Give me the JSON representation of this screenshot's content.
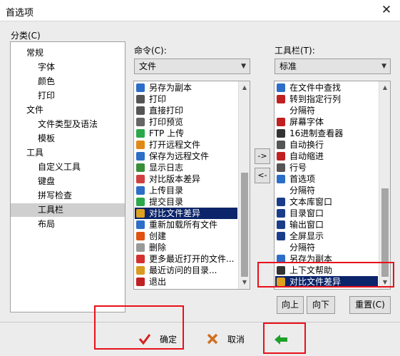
{
  "window": {
    "title": "首选项",
    "close_glyph": "✕"
  },
  "categories": {
    "label": "分类(C)",
    "items": [
      {
        "label": "常规",
        "level": 0
      },
      {
        "label": "字体",
        "level": 1
      },
      {
        "label": "颜色",
        "level": 1
      },
      {
        "label": "打印",
        "level": 1
      },
      {
        "label": "文件",
        "level": 0
      },
      {
        "label": "文件类型及语法",
        "level": 1
      },
      {
        "label": "模板",
        "level": 1
      },
      {
        "label": "工具",
        "level": 0
      },
      {
        "label": "自定义工具",
        "level": 1
      },
      {
        "label": "键盘",
        "level": 1
      },
      {
        "label": "拼写检查",
        "level": 1
      },
      {
        "label": "工具栏",
        "level": 1,
        "selected": true
      },
      {
        "label": "布局",
        "level": 1
      }
    ]
  },
  "commands": {
    "label": "命令(C):",
    "selected_group": "文件",
    "items": [
      {
        "label": "另存为副本",
        "icon": "save-copy-icon",
        "color": "#2c6ec7"
      },
      {
        "label": "打印",
        "icon": "print-icon",
        "color": "#555555"
      },
      {
        "label": "直接打印",
        "icon": "direct-print-icon",
        "color": "#555555"
      },
      {
        "label": "打印预览",
        "icon": "print-preview-icon",
        "color": "#666666"
      },
      {
        "label": "FTP 上传",
        "icon": "ftp-upload-icon",
        "color": "#2aa84a"
      },
      {
        "label": "打开远程文件",
        "icon": "open-remote-icon",
        "color": "#e08a16"
      },
      {
        "label": "保存为远程文件",
        "icon": "save-remote-icon",
        "color": "#2c6ec7"
      },
      {
        "label": "显示日志",
        "icon": "log-icon",
        "color": "#3a8e3a"
      },
      {
        "label": "对比版本差异",
        "icon": "version-diff-icon",
        "color": "#d04040"
      },
      {
        "label": "上传目录",
        "icon": "upload-dir-icon",
        "color": "#2c6ec7"
      },
      {
        "label": "提交目录",
        "icon": "commit-dir-icon",
        "color": "#2aa84a"
      },
      {
        "label": "对比文件差异",
        "icon": "file-diff-icon",
        "color": "#e0a020",
        "highlight": true
      },
      {
        "label": "重新加载所有文件",
        "icon": "reload-all-icon",
        "color": "#2c6ec7"
      },
      {
        "label": "创建",
        "icon": "create-icon",
        "color": "#e05010"
      },
      {
        "label": "删除",
        "icon": "delete-icon",
        "color": "#999999"
      },
      {
        "label": "更多最近打开的文件...",
        "icon": "recent-files-icon",
        "color": "#d43030"
      },
      {
        "label": "最近访问的目录...",
        "icon": "recent-dirs-icon",
        "color": "#d89a20"
      },
      {
        "label": "退出",
        "icon": "exit-icon",
        "color": "#c02020"
      }
    ]
  },
  "toolbar": {
    "label": "工具栏(T):",
    "selected_toolbar": "标准",
    "items": [
      {
        "label": "在文件中查找",
        "icon": "find-in-files-icon",
        "color": "#2c6ec7"
      },
      {
        "label": "转到指定行列",
        "icon": "goto-line-icon",
        "color": "#c02020"
      },
      {
        "label": "分隔符",
        "icon": "",
        "color": ""
      },
      {
        "label": "屏幕字体",
        "icon": "screen-font-icon",
        "color": "#c02020"
      },
      {
        "label": "16进制查看器",
        "icon": "hex-viewer-icon",
        "color": "#333333"
      },
      {
        "label": "自动换行",
        "icon": "word-wrap-icon",
        "color": "#555555"
      },
      {
        "label": "自动缩进",
        "icon": "auto-indent-icon",
        "color": "#c02020"
      },
      {
        "label": "行号",
        "icon": "line-number-icon",
        "color": "#555555"
      },
      {
        "label": "首选项",
        "icon": "preferences-icon",
        "color": "#2c6ec7"
      },
      {
        "label": "分隔符",
        "icon": "",
        "color": ""
      },
      {
        "label": "文本库窗口",
        "icon": "text-lib-window-icon",
        "color": "#1a3d8a"
      },
      {
        "label": "目录窗口",
        "icon": "dir-window-icon",
        "color": "#1a3d8a"
      },
      {
        "label": "输出窗口",
        "icon": "output-window-icon",
        "color": "#1a3d8a"
      },
      {
        "label": "全屏显示",
        "icon": "fullscreen-icon",
        "color": "#1a3d8a"
      },
      {
        "label": "分隔符",
        "icon": "",
        "color": ""
      },
      {
        "label": "另存为副本",
        "icon": "save-copy-icon",
        "color": "#2c6ec7"
      },
      {
        "label": "上下文帮助",
        "icon": "context-help-icon",
        "color": "#333333"
      },
      {
        "label": "对比文件差异",
        "icon": "file-diff-icon",
        "color": "#e0a020",
        "highlight": true
      }
    ]
  },
  "transfer": {
    "add_label": "->",
    "remove_label": "<-"
  },
  "order_buttons": {
    "up": "向上",
    "down": "向下",
    "reset": "重置(C)"
  },
  "footer": {
    "ok_label": "确定",
    "cancel_label": "取消"
  },
  "colors": {
    "highlight": "#0b246a",
    "annotation_red": "#e8101a",
    "ok_check": "#d42020",
    "cancel_x": "#d07020",
    "apply_arrow": "#1fa02a"
  }
}
